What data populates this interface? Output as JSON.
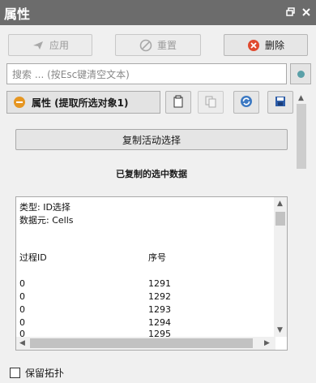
{
  "panel": {
    "title": "属性",
    "icons": [
      "restore-icon",
      "close-icon"
    ]
  },
  "toolbar": {
    "apply_label": "应用",
    "reset_label": "重置",
    "delete_label": "删除"
  },
  "search": {
    "placeholder": "搜索 ... (按Esc键清空文本)"
  },
  "properties": {
    "header_label": "属性 (提取所选对象1)",
    "accent": "#e69621",
    "icon_buttons": [
      "copy-icon",
      "paste-icon",
      "refresh-icon",
      "save-icon"
    ]
  },
  "selection": {
    "copy_button_label": "复制活动选择",
    "copied_heading": "已复制的选中数据",
    "type_line": "类型: ID选择",
    "element_line": "数据元: Cells",
    "col_process": "过程ID",
    "col_index": "序号",
    "rows": [
      {
        "process": "0",
        "index": "1291"
      },
      {
        "process": "0",
        "index": "1292"
      },
      {
        "process": "0",
        "index": "1293"
      },
      {
        "process": "0",
        "index": "1294"
      },
      {
        "process": "0",
        "index": "1295"
      }
    ]
  },
  "options": {
    "preserve_topology_label": "保留拓扑",
    "preserve_topology_checked": false
  }
}
